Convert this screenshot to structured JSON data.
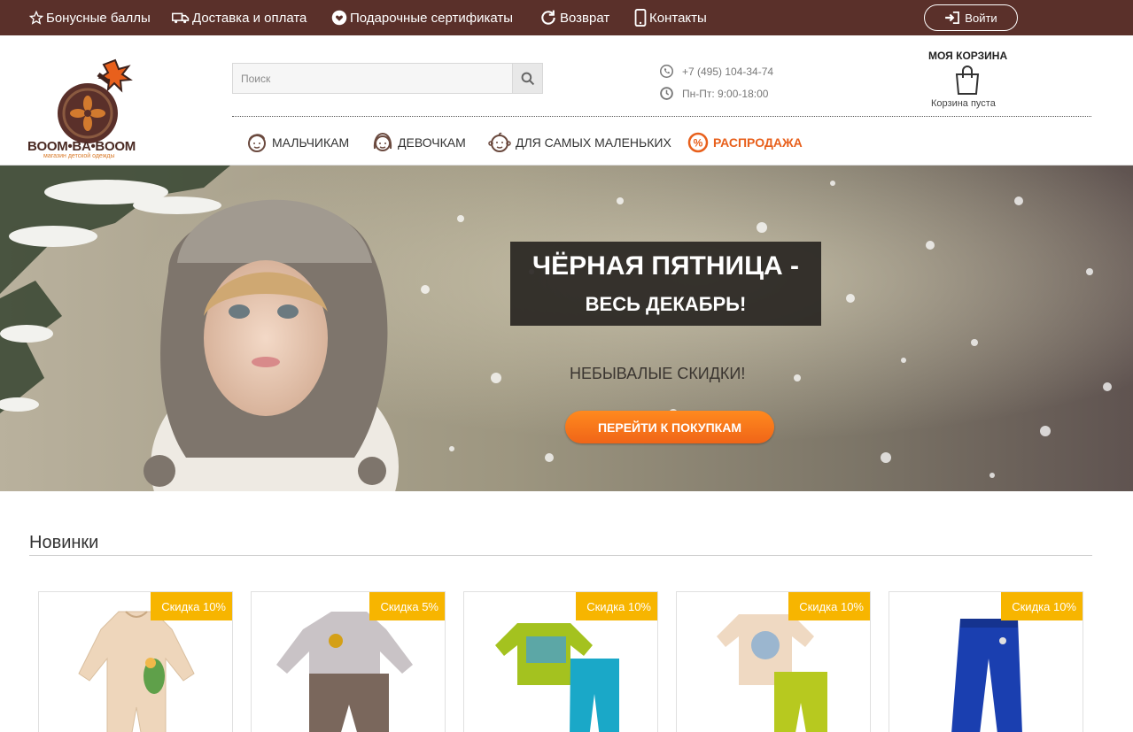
{
  "topbar": {
    "links": [
      {
        "label": "Бонусные баллы",
        "icon": "star-icon"
      },
      {
        "label": "Доставка и оплата",
        "icon": "truck-icon"
      },
      {
        "label": "Подарочные сертификаты",
        "icon": "heart-icon"
      },
      {
        "label": "Возврат",
        "icon": "refresh-icon"
      },
      {
        "label": "Контакты",
        "icon": "phone-icon"
      }
    ],
    "login_label": "Войти"
  },
  "logo": {
    "text": "BOOM•BA•BOOM",
    "subtitle": "магазин детской одежды"
  },
  "search": {
    "placeholder": "Поиск"
  },
  "contacts": {
    "phone": "+7 (495) 104-34-74",
    "hours": "Пн-Пт: 9:00-18:00"
  },
  "cart": {
    "title": "МОЯ КОРЗИНА",
    "status": "Корзина пуста"
  },
  "nav": [
    {
      "label": "МАЛЬЧИКАМ",
      "icon": "boy-face-icon"
    },
    {
      "label": "ДЕВОЧКАМ",
      "icon": "girl-face-icon"
    },
    {
      "label": "ДЛЯ САМЫХ МАЛЕНЬКИХ",
      "icon": "baby-face-icon"
    },
    {
      "label": "РАСПРОДАЖА",
      "icon": "percent-icon"
    }
  ],
  "hero": {
    "title_line1": "ЧЁРНАЯ ПЯТНИЦА -",
    "title_line2": "ВЕСЬ ДЕКАБРЬ!",
    "subtitle": "НЕБЫВАЛЫЕ СКИДКИ!",
    "cta": "ПЕРЕЙТИ К ПОКУПКАМ"
  },
  "new_products": {
    "title": "Новинки",
    "items": [
      {
        "badge": "Скидка 10%"
      },
      {
        "badge": "Скидка 5%"
      },
      {
        "badge": "Скидка 10%"
      },
      {
        "badge": "Скидка 10%"
      },
      {
        "badge": "Скидка 10%"
      }
    ]
  },
  "colors": {
    "topbar": "#5a302a",
    "accent": "#f06518",
    "badge": "#f7b500"
  }
}
